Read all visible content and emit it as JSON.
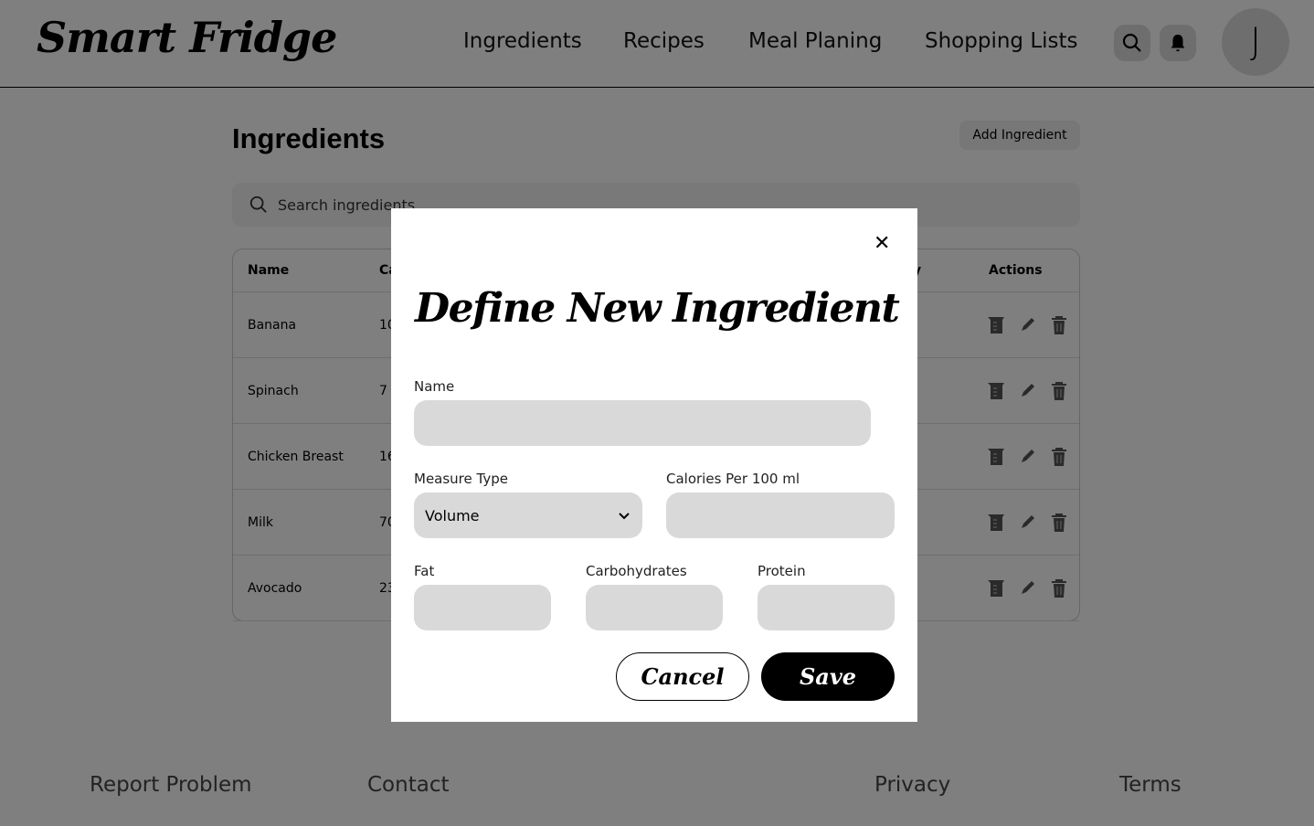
{
  "header": {
    "logo": "Smart Fridge",
    "nav": [
      "Ingredients",
      "Recipes",
      "Meal Planing",
      "Shopping Lists"
    ],
    "avatar_initial": "J"
  },
  "page": {
    "title": "Ingredients",
    "add_button": "Add Ingredient",
    "search_placeholder": "Search  ingredients"
  },
  "table": {
    "headers": {
      "name": "Name",
      "col2": "Ca",
      "col3": "y",
      "actions": "Actions"
    },
    "rows": [
      {
        "name": "Banana",
        "col2": "10"
      },
      {
        "name": "Spinach",
        "col2": "7"
      },
      {
        "name": "Chicken Breast",
        "col2": "16"
      },
      {
        "name": "Milk",
        "col2": "70"
      },
      {
        "name": "Avocado",
        "col2": "23"
      }
    ]
  },
  "footer": {
    "report": "Report Problem",
    "contact": "Contact",
    "privacy": "Privacy",
    "terms": "Terms"
  },
  "modal": {
    "title": "Define New Ingredient",
    "name_label": "Name",
    "measure_label": "Measure Type",
    "measure_value": "Volume",
    "calories_label": "Calories Per 100 ml",
    "fat_label": "Fat",
    "carbs_label": "Carbohydrates",
    "protein_label": "Protein",
    "cancel": "Cancel",
    "save": "Save"
  }
}
